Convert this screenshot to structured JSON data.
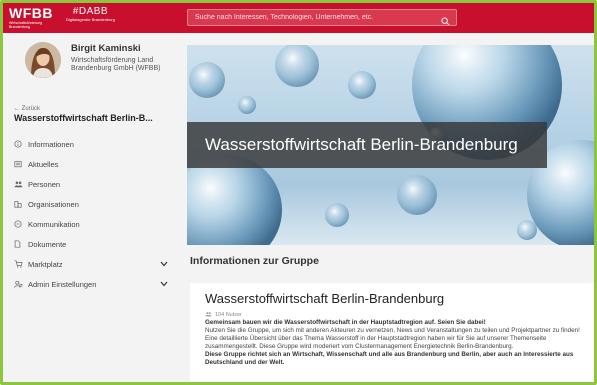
{
  "header": {
    "logo_wfbb": "WFBB",
    "logo_wfbb_sub": "Wirtschaftsförderung Brandenburg",
    "logo_dabb": "#DABB",
    "logo_dabb_sub": "Digitalagentur Brandenburg",
    "search_placeholder": "Suche nach Interessen, Technologien, Unternehmen, etc.",
    "accent_color": "#c8102e",
    "frame_color": "#8cc63f"
  },
  "profile": {
    "name": "Birgit Kaminski",
    "org": "Wirtschaftsförderung Land Brandenburg GmbH (WFBB)"
  },
  "nav": {
    "back_label": "← Zurück",
    "group_title": "Wasserstoffwirtschaft Berlin-B...",
    "items": [
      {
        "label": "Informationen",
        "icon": "info-icon"
      },
      {
        "label": "Aktuelles",
        "icon": "news-icon"
      },
      {
        "label": "Personen",
        "icon": "people-icon"
      },
      {
        "label": "Organisationen",
        "icon": "building-icon"
      },
      {
        "label": "Kommunikation",
        "icon": "chat-icon"
      },
      {
        "label": "Dokumente",
        "icon": "document-icon"
      },
      {
        "label": "Marktplatz",
        "icon": "cart-icon"
      },
      {
        "label": "Admin Einstellungen",
        "icon": "admin-icon"
      }
    ]
  },
  "main": {
    "hero_title": "Wasserstoffwirtschaft Berlin-Brandenburg",
    "section_title": "Informationen zur Gruppe",
    "card_title": "Wasserstoffwirtschaft Berlin-Brandenburg",
    "card_users": "104 Nutzer",
    "card_desc_lead": "Gemeinsam bauen wir die Wasserstoffwirtschaft in der Hauptstadtregion auf. Seien Sie dabei!",
    "card_desc_body": "Nutzen Sie die Gruppe, um sich mit anderen Akteuren zu vernetzen, News und Veranstaltungen zu teilen und Projektpartner zu finden! Eine detaillierte Übersicht über das Thema Wasserstoff in der Hauptstadtregion haben wir für Sie auf unserer Themenseite zusammengestellt. Diese Gruppe wird moderiert vom Clustermanagement Energietechnik Berlin-Brandenburg.",
    "card_desc_tail": "Diese Gruppe richtet sich an Wirtschaft, Wissenschaft und alle aus Brandenburg und Berlin, aber auch an Interessierte aus Deutschland und der Welt."
  }
}
